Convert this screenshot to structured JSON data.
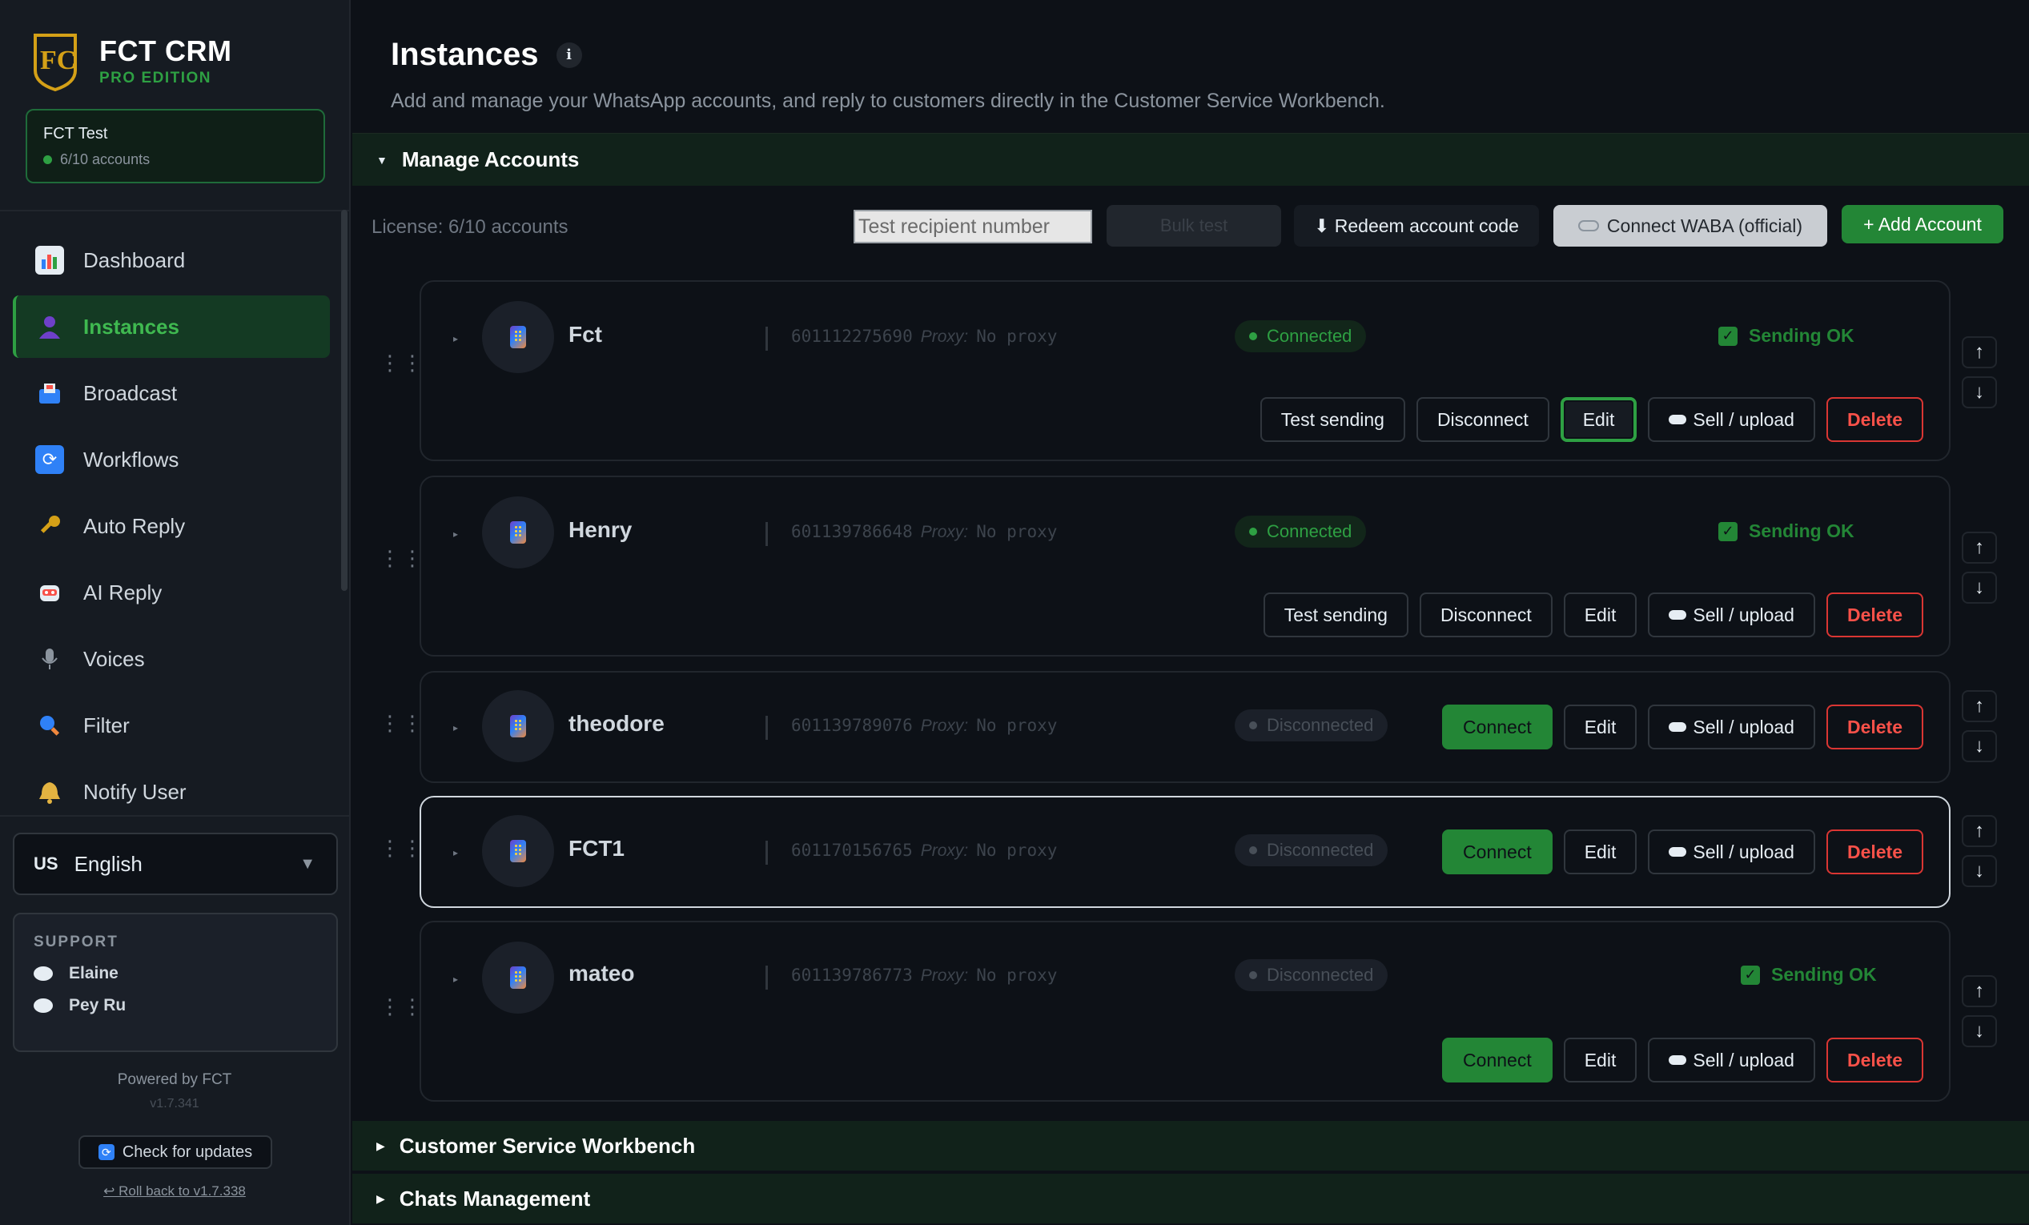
{
  "brand": {
    "name": "FCT CRM",
    "edition": "PRO EDITION"
  },
  "account": {
    "name": "FCT Test",
    "accounts": "6/10 accounts"
  },
  "nav": [
    {
      "label": "Dashboard",
      "icon": "chart-icon"
    },
    {
      "label": "Instances",
      "icon": "user-icon"
    },
    {
      "label": "Broadcast",
      "icon": "inbox-icon"
    },
    {
      "label": "Workflows",
      "icon": "refresh-icon"
    },
    {
      "label": "Auto Reply",
      "icon": "key-icon"
    },
    {
      "label": "AI Reply",
      "icon": "robot-icon"
    },
    {
      "label": "Voices",
      "icon": "microphone-icon"
    },
    {
      "label": "Filter",
      "icon": "magnifier-icon"
    },
    {
      "label": "Notify User",
      "icon": "bell-icon"
    }
  ],
  "language": {
    "code": "US",
    "label": "English"
  },
  "support": {
    "title": "SUPPORT",
    "contacts": [
      "Elaine",
      "Pey Ru"
    ]
  },
  "footer": {
    "powered": "Powered by FCT",
    "version": "v1.7.341",
    "check_updates": "Check for updates",
    "rollback": "↩ Roll back to v1.7.338"
  },
  "page": {
    "title": "Instances",
    "description": "Add and manage your WhatsApp accounts, and reply to customers directly in the Customer Service Workbench."
  },
  "manage": {
    "title": "Manage Accounts",
    "license": "License: 6/10 accounts",
    "recipient_placeholder": "Test recipient number",
    "disabled_button": "Bulk test",
    "redeem": "⬇ Redeem account code",
    "waba": "Connect WABA (official)",
    "add": "+ Add Account"
  },
  "labels": {
    "proxy": "Proxy:",
    "test_sending": "Test sending",
    "disconnect": "Disconnect",
    "connect": "Connect",
    "edit": "Edit",
    "sell_upload": "Sell / upload",
    "delete": "Delete",
    "sending_ok": "Sending OK",
    "up": "↑",
    "down": "↓"
  },
  "instances": [
    {
      "name": "Fct",
      "number": "601112275690",
      "proxy": "No proxy",
      "status": "Connected",
      "sending_ok": true
    },
    {
      "name": "Henry",
      "number": "601139786648",
      "proxy": "No proxy",
      "status": "Connected",
      "sending_ok": true
    },
    {
      "name": "theodore",
      "number": "601139789076",
      "proxy": "No proxy",
      "status": "Disconnected",
      "sending_ok": false
    },
    {
      "name": "FCT1",
      "number": "601170156765",
      "proxy": "No proxy",
      "status": "Disconnected",
      "sending_ok": false
    },
    {
      "name": "mateo",
      "number": "601139786773",
      "proxy": "No proxy",
      "status": "Disconnected",
      "sending_ok": true
    }
  ],
  "sections": {
    "workbench": "Customer Service Workbench",
    "chats": "Chats Management"
  },
  "colors": {
    "accent": "#2ea043",
    "danger": "#f85149",
    "background": "#0d1117"
  }
}
